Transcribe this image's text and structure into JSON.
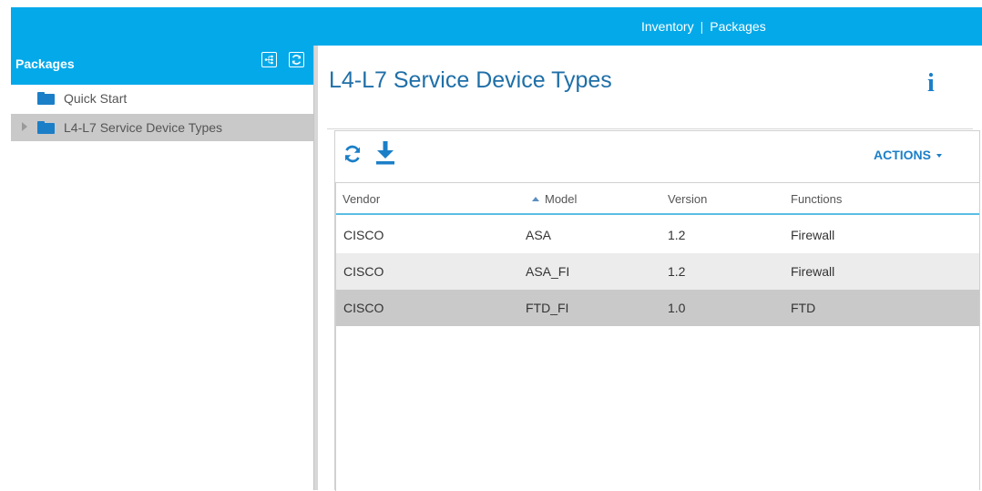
{
  "topbar": {
    "crumb_inventory": "Inventory",
    "crumb_sep": "|",
    "crumb_packages": "Packages",
    "bg_color": "#04a9e9"
  },
  "sidebar": {
    "title": "Packages",
    "buttons": [
      {
        "name": "tree-view",
        "icon": "network-tree-icon"
      },
      {
        "name": "refresh",
        "icon": "refresh-icon"
      }
    ],
    "items": [
      {
        "label": "Quick Start",
        "icon": "folder-icon",
        "selected": false,
        "expandable": false
      },
      {
        "label": "L4-L7 Service Device Types",
        "icon": "folder-icon",
        "selected": true,
        "expandable": true
      }
    ]
  },
  "main": {
    "title": "L4-L7 Service Device Types",
    "info_icon": "i",
    "toolbar": {
      "refresh_icon": "refresh-icon",
      "download_icon": "download-icon",
      "actions_label": "ACTIONS"
    },
    "table": {
      "columns": [
        "Vendor",
        "Model",
        "Version",
        "Functions"
      ],
      "sorted_column": "Model",
      "sort_direction": "ascending",
      "rows": [
        {
          "vendor": "CISCO",
          "model": "ASA",
          "version": "1.2",
          "functions": "Firewall"
        },
        {
          "vendor": "CISCO",
          "model": "ASA_FI",
          "version": "1.2",
          "functions": "Firewall"
        },
        {
          "vendor": "CISCO",
          "model": "FTD_FI",
          "version": "1.0",
          "functions": "FTD"
        }
      ]
    }
  },
  "colors": {
    "accent": "#04a9e9",
    "title": "#1f6fa8",
    "link": "#1b7fc7",
    "selected_row": "#c9c9c9",
    "alt_row": "#ececec"
  }
}
